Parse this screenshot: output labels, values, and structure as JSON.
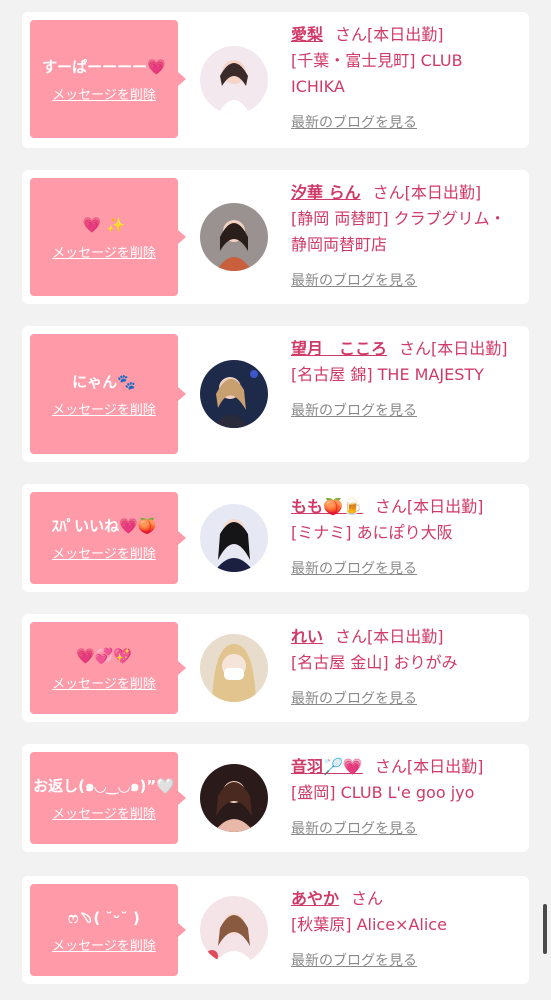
{
  "delete_label": "メッセージを削除",
  "blog_label": "最新のブログを見る",
  "accent_color": "#d03a68",
  "bubble_color": "#ff9aa8",
  "cards": [
    {
      "message": "すーぱーーーー💗",
      "name": "愛梨",
      "suffix": "さん[本日出勤]",
      "shop": "[千葉・富士見町] CLUB ICHIKA"
    },
    {
      "message": "💗 ✨",
      "name": "汐華 らん",
      "suffix": "さん[本日出勤]",
      "shop": "[静岡 両替町] クラブグリム・静岡両替町店"
    },
    {
      "message": "にゃん🐾",
      "name": "望月　こころ",
      "suffix": "さん[本日出勤]",
      "shop": "[名古屋 錦] THE MAJESTY"
    },
    {
      "message": "ｽﾊﾟいいね💗🍑",
      "name": "もも🍑🍺",
      "suffix": "さん[本日出勤]",
      "shop": "[ミナミ] あにぽり大阪"
    },
    {
      "message": "💗💞💖",
      "name": "れい",
      "suffix": "さん[本日出勤]",
      "shop": "[名古屋 金山] おりがみ"
    },
    {
      "message": "お返し(๑◡‿◡๑)”🤍",
      "name": "音羽🏸💗",
      "suffix": "さん[本日出勤]",
      "shop": "[盛岡] CLUB L'e goo jyo"
    },
    {
      "message": "ෆ﹆( ˘ᵕ˘ )",
      "name": "あやか",
      "suffix": "さん",
      "shop": "[秋葉原] Alice×Alice"
    }
  ]
}
